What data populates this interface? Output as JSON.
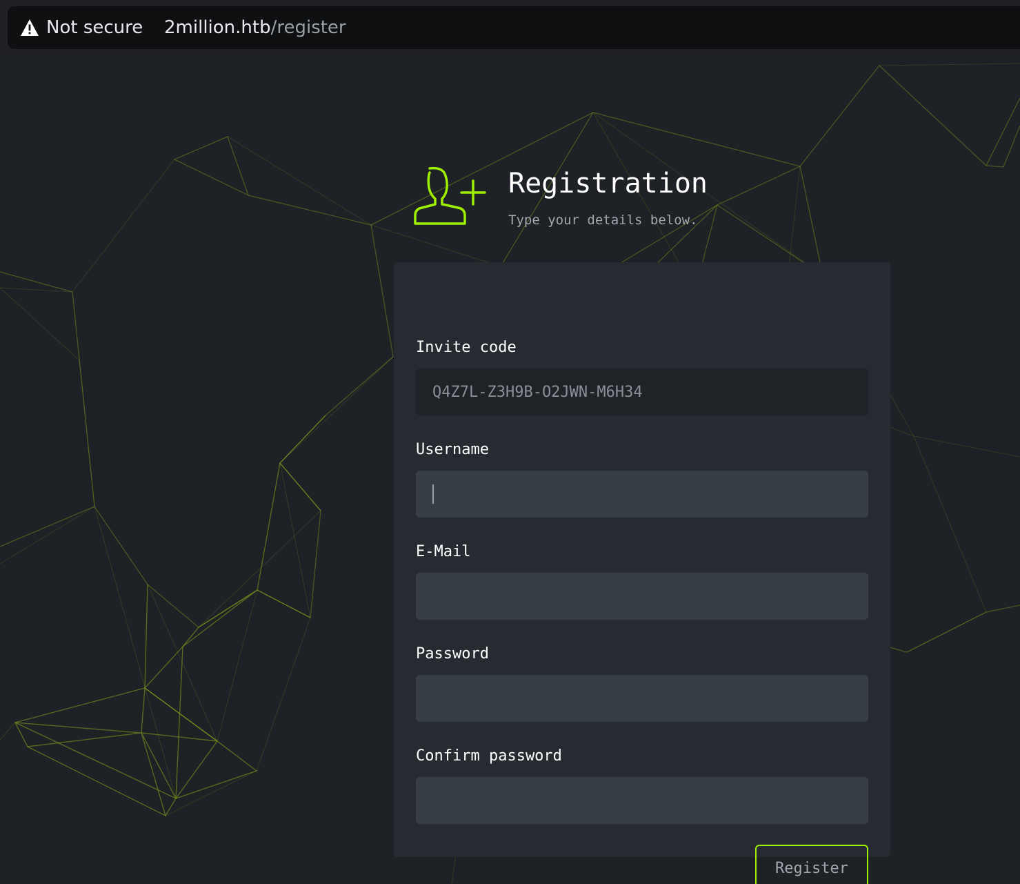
{
  "browser": {
    "security_label": "Not secure",
    "url_host": "2million.htb",
    "url_path": "/register"
  },
  "header": {
    "icon": "user-plus-icon",
    "title": "Registration",
    "subtitle": "Type your details below."
  },
  "form": {
    "invite_code": {
      "label": "Invite code",
      "value": "Q4Z7L-Z3H9B-O2JWN-M6H34"
    },
    "username": {
      "label": "Username",
      "value": ""
    },
    "email": {
      "label": "E-Mail",
      "value": ""
    },
    "password": {
      "label": "Password",
      "value": ""
    },
    "confirm_password": {
      "label": "Confirm password",
      "value": ""
    },
    "submit_label": "Register"
  },
  "colors": {
    "accent": "#9fef00",
    "page_background": "#1e2126",
    "card_background": "#272b31",
    "input_background": "#383e46"
  }
}
